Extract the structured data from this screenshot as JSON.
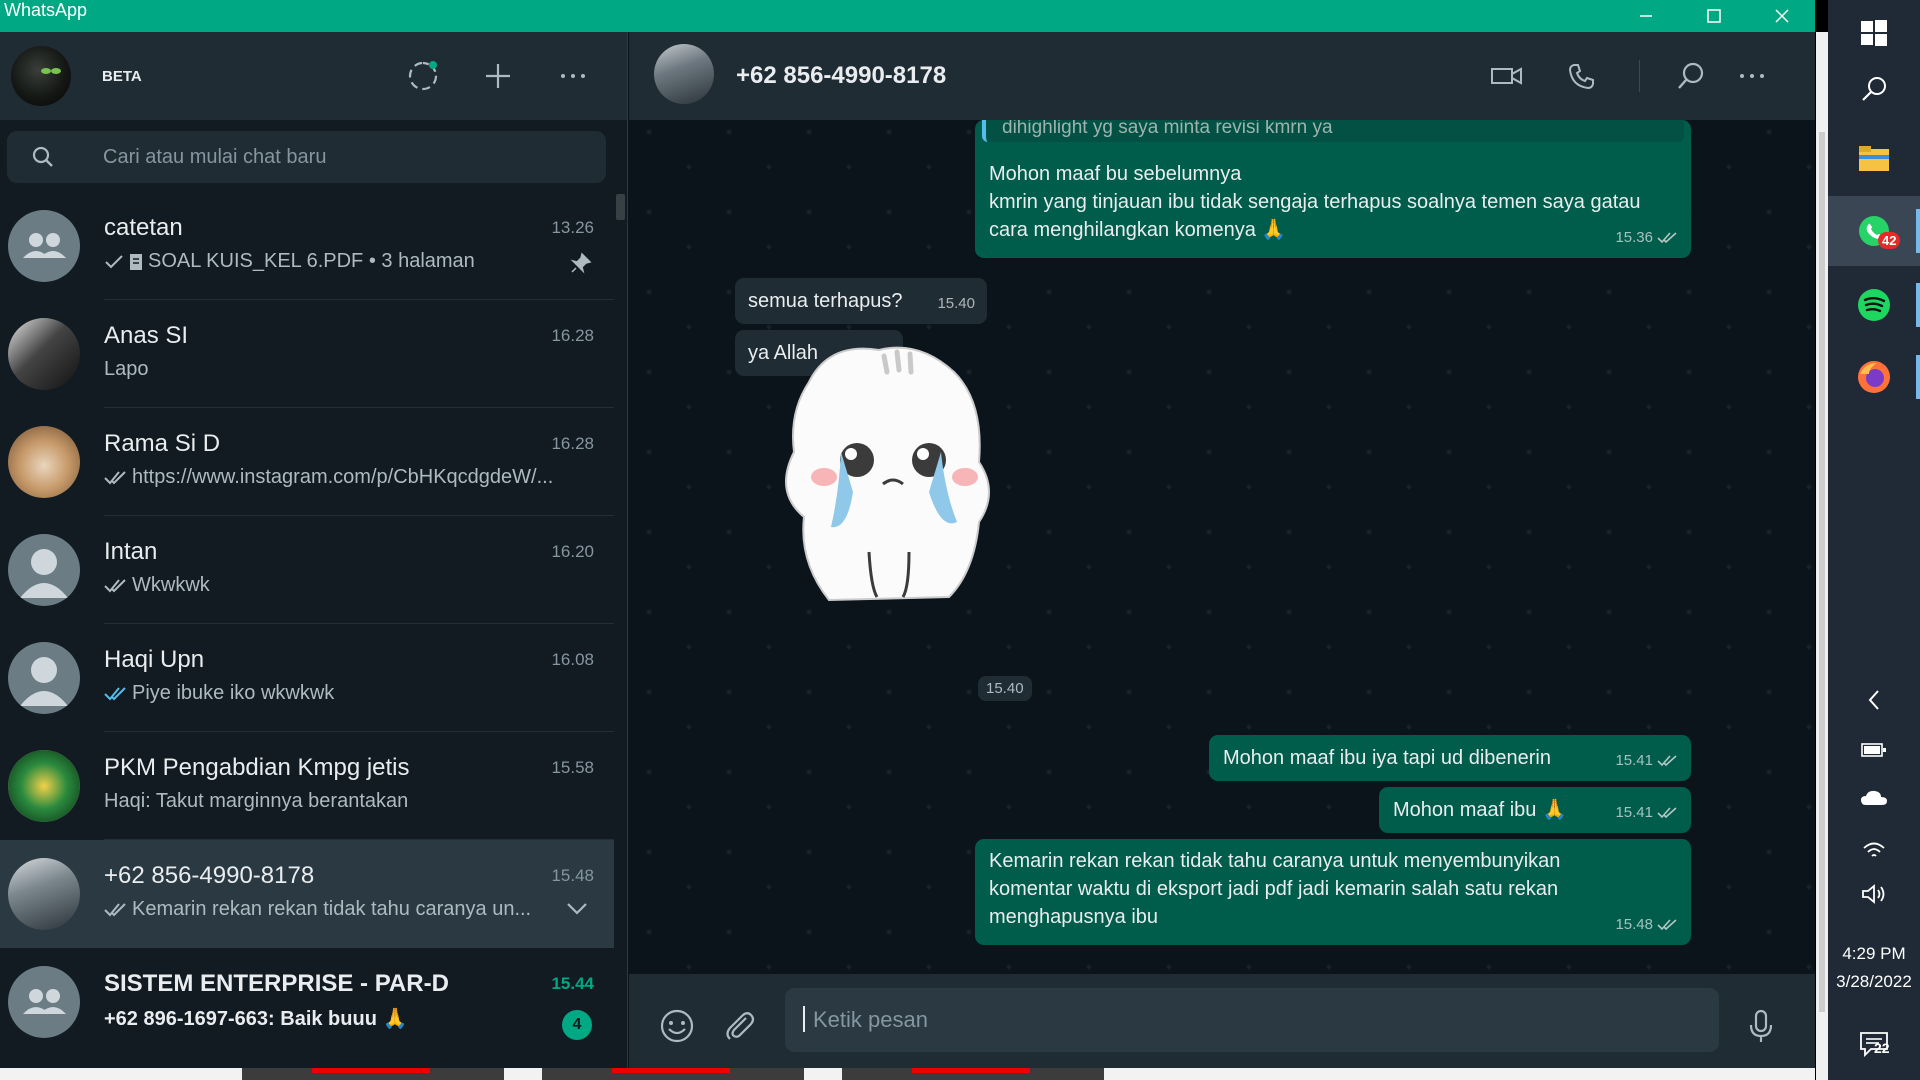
{
  "window": {
    "title": "WhatsApp"
  },
  "sidebar": {
    "beta_label": "BETA",
    "search_placeholder": "Cari atau mulai chat baru",
    "chats": [
      {
        "name": "catetan",
        "time": "13.26",
        "preview": "SOAL KUIS_KEL 6.PDF • 3 halaman",
        "status": "sent",
        "attachment": "document-icon",
        "pinned": true,
        "avatar": "group"
      },
      {
        "name": "Anas SI",
        "time": "16.28",
        "preview": "Lapo",
        "status": "none",
        "avatar": "photo"
      },
      {
        "name": "Rama Si D",
        "time": "16.28",
        "preview": "https://www.instagram.com/p/CbHKqcdgdeW/...",
        "status": "delivered",
        "avatar": "cat"
      },
      {
        "name": "Intan",
        "time": "16.20",
        "preview": "Wkwkwk",
        "status": "delivered",
        "avatar": "default"
      },
      {
        "name": "Haqi Upn",
        "time": "16.08",
        "preview": "Piye ibuke iko wkwkwk",
        "status": "read",
        "avatar": "default"
      },
      {
        "name": "PKM Pengabdian Kmpg jetis",
        "time": "15.58",
        "preview": "Haqi: Takut marginnya berantakan",
        "status": "none",
        "avatar": "emblem"
      },
      {
        "name": "+62 856-4990-8178",
        "time": "15.48",
        "preview": "Kemarin rekan rekan tidak tahu caranya un...",
        "status": "delivered",
        "avatar": "photo",
        "active": true
      },
      {
        "name": "SISTEM ENTERPRISE - PAR-D",
        "time": "15.44",
        "preview": "+62 896-1697-663: Baik buuu 🙏",
        "status": "none",
        "avatar": "group",
        "unread": "4"
      }
    ]
  },
  "conversation": {
    "contact_name": "+62 856-4990-8178",
    "quoted_text": "dihighlight yg saya minta revisi kmrn ya",
    "messages": [
      {
        "dir": "out",
        "lines": [
          "Mohon maaf bu  sebelumnya",
          "kmrin yang tinjauan ibu tidak sengaja terhapus soalnya temen saya gatau",
          "cara menghilangkan komenya 🙏"
        ],
        "time": "15.36",
        "status": "delivered"
      },
      {
        "dir": "in",
        "lines": [
          "semua terhapus?"
        ],
        "time": "15.40"
      },
      {
        "dir": "in",
        "lines": [
          "ya Allah"
        ],
        "time": "15.40"
      },
      {
        "dir": "sticker",
        "time": "15.40"
      },
      {
        "dir": "out",
        "lines": [
          "Mohon maaf ibu iya tapi ud dibenerin"
        ],
        "time": "15.41",
        "status": "delivered"
      },
      {
        "dir": "out",
        "lines": [
          "Mohon maaf ibu 🙏"
        ],
        "time": "15.41",
        "status": "delivered"
      },
      {
        "dir": "out",
        "lines": [
          "Kemarin rekan rekan tidak tahu caranya untuk menyembunyikan",
          "komentar waktu di eksport jadi pdf jadi kemarin salah satu rekan",
          "menghapusnya ibu"
        ],
        "time": "15.48",
        "status": "delivered"
      }
    ],
    "composer_placeholder": "Ketik pesan"
  },
  "taskbar": {
    "whatsapp_badge": "42",
    "time": "4:29 PM",
    "date": "3/28/2022",
    "notifications": "22"
  },
  "colors": {
    "accent": "#00a884",
    "outgoing_bubble": "#005c4b",
    "incoming_bubble": "#202c33",
    "read_tick": "#53bdeb"
  }
}
